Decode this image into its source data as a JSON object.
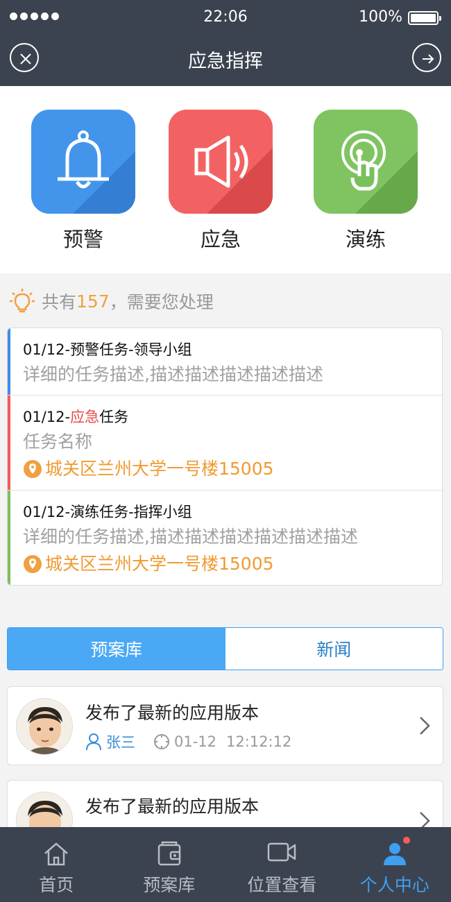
{
  "status": {
    "time": "22:06",
    "battery": "100%"
  },
  "nav": {
    "title": "应急指挥"
  },
  "categories": [
    {
      "label": "预警",
      "icon": "bell-icon",
      "color": "#3d8ee8"
    },
    {
      "label": "应急",
      "icon": "speaker-icon",
      "color": "#f25a5a"
    },
    {
      "label": "演练",
      "icon": "tap-hand-icon",
      "color": "#7ac05a"
    }
  ],
  "notice": {
    "prefix": "共有",
    "count": "157",
    "suffix": "，需要您处理"
  },
  "tasks": [
    {
      "title": "01/12-预警任务-领导小组",
      "desc": "详细的任务描述,描述描述描述描述描述",
      "bar_color": "#3d8ee8"
    },
    {
      "title_pre": "01/12-",
      "title_hl": "应急",
      "title_post": "任务",
      "desc": "任务名称",
      "location": "城关区兰州大学一号楼15005",
      "bar_color": "#f25a5a"
    },
    {
      "title": "01/12-演练任务-指挥小组",
      "desc": "详细的任务描述,描述描述描述描述描述描述",
      "location": "城关区兰州大学一号楼15005",
      "bar_color": "#7ac05a"
    }
  ],
  "tabs": [
    {
      "label": "预案库",
      "active": true
    },
    {
      "label": "新闻",
      "active": false
    }
  ],
  "news": [
    {
      "title": "发布了最新的应用版本",
      "user": "张三",
      "date": "01-12",
      "time": "12:12:12"
    },
    {
      "title": "发布了最新的应用版本"
    }
  ],
  "bottom_nav": [
    {
      "label": "首页",
      "icon": "home-icon"
    },
    {
      "label": "预案库",
      "icon": "wallet-icon"
    },
    {
      "label": "位置查看",
      "icon": "video-camera-icon"
    },
    {
      "label": "个人中心",
      "icon": "user-icon",
      "active": true
    }
  ]
}
